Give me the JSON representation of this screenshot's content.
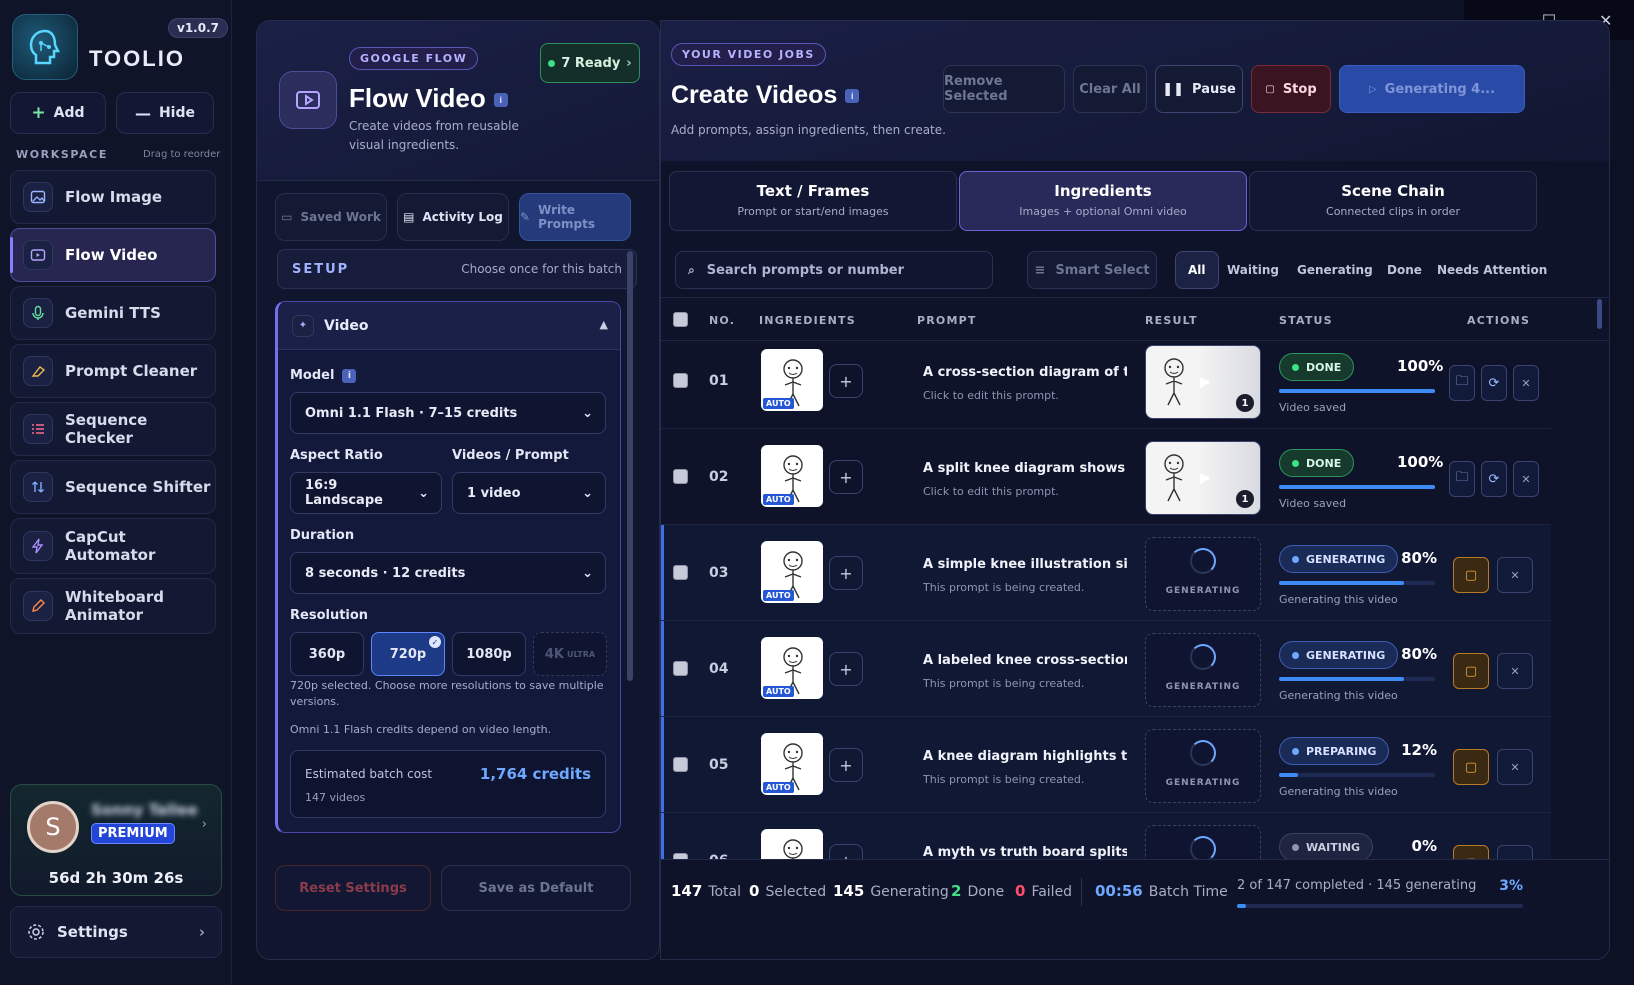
{
  "app": {
    "brand": "TOOLIO",
    "version": "v1.0.7"
  },
  "sidebar": {
    "add_label": "Add",
    "hide_label": "Hide",
    "workspace_label": "WORKSPACE",
    "drag_hint": "Drag to reorder",
    "items": [
      {
        "label": "Flow Image",
        "icon": "image-icon"
      },
      {
        "label": "Flow Video",
        "icon": "video-icon"
      },
      {
        "label": "Gemini TTS",
        "icon": "microphone-icon"
      },
      {
        "label": "Prompt Cleaner",
        "icon": "eraser-icon"
      },
      {
        "label": "Sequence Checker",
        "icon": "list-check-icon"
      },
      {
        "label": "Sequence Shifter",
        "icon": "swap-vertical-icon"
      },
      {
        "label": "CapCut Automator",
        "icon": "lightning-icon"
      },
      {
        "label": "Whiteboard Animator",
        "icon": "pencil-icon"
      }
    ],
    "user": {
      "initial": "S",
      "name": "Sonny Tallee",
      "tier": "PREMIUM",
      "timer": "56d 2h 30m 26s"
    },
    "settings_label": "Settings"
  },
  "flow": {
    "badge": "GOOGLE FLOW",
    "ready": "7 Ready",
    "title": "Flow Video",
    "subtitle_line1": "Create videos from reusable",
    "subtitle_line2": "visual ingredients.",
    "tabs": {
      "saved": "Saved Work",
      "activity": "Activity Log",
      "write": "Write Prompts"
    },
    "setup": {
      "label": "SETUP",
      "hint": "Choose once for this batch"
    },
    "video_section": "Video",
    "model_label": "Model",
    "model_value": "Omni 1.1 Flash · 7–15 credits",
    "aspect_label": "Aspect Ratio",
    "aspect_value": "16:9 Landscape",
    "vpp_label": "Videos / Prompt",
    "vpp_value": "1 video",
    "duration_label": "Duration",
    "duration_value": "8 seconds · 12 credits",
    "resolution_label": "Resolution",
    "resolutions": [
      "360p",
      "720p",
      "1080p",
      "4K"
    ],
    "res_ultra": "ULTRA",
    "res_note_line1": "720p selected. Choose more resolutions to save multiple",
    "res_note_line2": "versions.",
    "credit_note": "Omni 1.1 Flash credits depend on video length.",
    "cost_label": "Estimated batch cost",
    "cost_value": "1,764 credits",
    "cost_videos": "147 videos",
    "reset_label": "Reset Settings",
    "default_label": "Save as Default"
  },
  "jobs": {
    "badge": "YOUR VIDEO JOBS",
    "title": "Create Videos",
    "subtitle": "Add prompts, assign ingredients, then create.",
    "actions": {
      "remove": "Remove Selected",
      "clear": "Clear All",
      "pause": "Pause",
      "stop": "Stop",
      "generating": "Generating 4..."
    },
    "modes": [
      {
        "title": "Text / Frames",
        "sub": "Prompt or start/end images"
      },
      {
        "title": "Ingredients",
        "sub": "Images + optional Omni video"
      },
      {
        "title": "Scene Chain",
        "sub": "Connected clips in order"
      }
    ],
    "search_placeholder": "Search prompts or number",
    "smart_select": "Smart Select",
    "filters": [
      "All",
      "Waiting",
      "Generating",
      "Done",
      "Needs Attention"
    ],
    "columns": {
      "no": "NO.",
      "ingredients": "INGREDIENTS",
      "prompt": "PROMPT",
      "result": "RESULT",
      "status": "STATUS",
      "actions": "ACTIONS"
    },
    "auto_tag": "AUTO",
    "result_count": "1",
    "pending_label": "GENERATING",
    "rows": [
      {
        "no": "01",
        "title": "A cross-section diagram of th...",
        "sub": "Click to edit this prompt.",
        "status": "DONE",
        "pct": "100%",
        "progress": 1.0,
        "note": "Video saved",
        "kind": "done"
      },
      {
        "no": "02",
        "title": "A split knee diagram shows th...",
        "sub": "Click to edit this prompt.",
        "status": "DONE",
        "pct": "100%",
        "progress": 1.0,
        "note": "Video saved",
        "kind": "done"
      },
      {
        "no": "03",
        "title": "A simple knee illustration sits...",
        "sub": "This prompt is being created.",
        "status": "GENERATING",
        "pct": "80%",
        "progress": 0.8,
        "note": "Generating this video",
        "kind": "gen"
      },
      {
        "no": "04",
        "title": "A labeled knee cross-section...",
        "sub": "This prompt is being created.",
        "status": "GENERATING",
        "pct": "80%",
        "progress": 0.8,
        "note": "Generating this video",
        "kind": "gen"
      },
      {
        "no": "05",
        "title": "A knee diagram highlights the...",
        "sub": "This prompt is being created.",
        "status": "PREPARING",
        "pct": "12%",
        "progress": 0.12,
        "note": "Generating this video",
        "kind": "gen"
      },
      {
        "no": "06",
        "title": "A myth vs truth board splits t...",
        "sub": "",
        "status": "WAITING",
        "pct": "0%",
        "progress": 0,
        "note": "",
        "kind": "wait"
      }
    ],
    "footer": {
      "total": "147",
      "total_label": "Total",
      "selected": "0",
      "selected_label": "Selected",
      "generating": "145",
      "generating_label": "Generating",
      "done": "2",
      "done_label": "Done",
      "failed": "0",
      "failed_label": "Failed",
      "batch_time": "00:56",
      "batch_label": "Batch Time",
      "summary": "2 of 147 completed · 145 generating",
      "percent": "3%",
      "progress": 0.03
    }
  },
  "colors": {
    "accent": "#7a6cf0",
    "done": "#3ee08a",
    "generating": "#3d8cf5",
    "stop": "#f0a640"
  }
}
